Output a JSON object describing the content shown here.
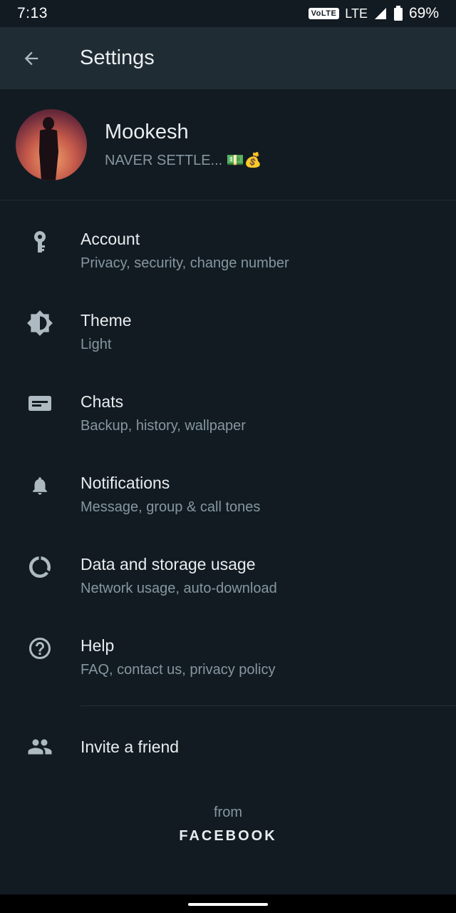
{
  "status_bar": {
    "time": "7:13",
    "volte": "VoLTE",
    "network": "LTE",
    "battery": "69%"
  },
  "app_bar": {
    "title": "Settings"
  },
  "profile": {
    "name": "Mookesh",
    "status": "NAVER SETTLE... 💵💰"
  },
  "menu": [
    {
      "title": "Account",
      "subtitle": "Privacy, security, change number",
      "icon": "key-icon"
    },
    {
      "title": "Theme",
      "subtitle": "Light",
      "icon": "theme-icon"
    },
    {
      "title": "Chats",
      "subtitle": "Backup, history, wallpaper",
      "icon": "chat-icon"
    },
    {
      "title": "Notifications",
      "subtitle": "Message, group & call tones",
      "icon": "bell-icon"
    },
    {
      "title": "Data and storage usage",
      "subtitle": "Network usage, auto-download",
      "icon": "data-usage-icon"
    },
    {
      "title": "Help",
      "subtitle": "FAQ, contact us, privacy policy",
      "icon": "help-icon"
    }
  ],
  "invite": {
    "label": "Invite a friend",
    "icon": "people-icon"
  },
  "footer": {
    "from": "from",
    "brand": "FACEBOOK"
  },
  "colors": {
    "background": "#121b22",
    "app_bar": "#202c33",
    "icon": "#aebac1",
    "secondary_text": "#8696a0",
    "primary_text": "#e9edef"
  }
}
